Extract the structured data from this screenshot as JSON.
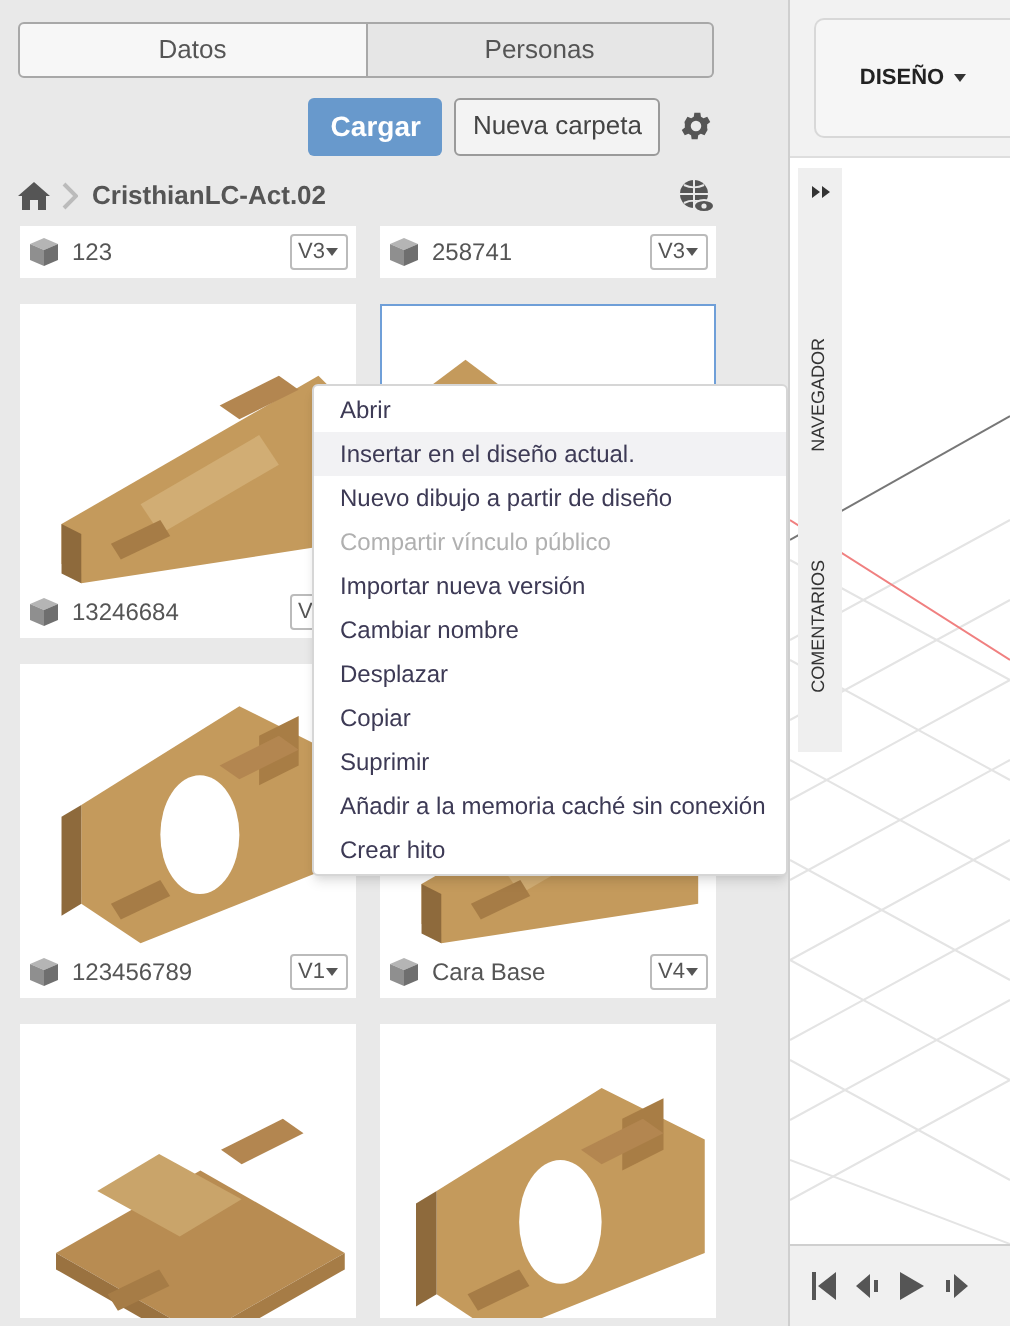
{
  "tabs": [
    {
      "label": "Datos",
      "selected": true
    },
    {
      "label": "Personas",
      "selected": false
    }
  ],
  "toolbar": {
    "upload_button": "Cargar",
    "new_folder_button": "Nueva carpeta"
  },
  "breadcrumb": {
    "project": "CristhianLC-Act.02"
  },
  "cards": [
    {
      "kind": "label_only",
      "name": "123",
      "version": "V3"
    },
    {
      "kind": "label_only",
      "name": "258741",
      "version": "V3"
    },
    {
      "kind": "full",
      "name": "13246684",
      "version": "V",
      "selected": false
    },
    {
      "kind": "image_only",
      "selected": true
    },
    {
      "kind": "full",
      "name": "123456789",
      "version": "V1",
      "selected": false
    },
    {
      "kind": "full",
      "name": "Cara Base",
      "version": "V4",
      "selected": false
    },
    {
      "kind": "image_only",
      "selected": false
    },
    {
      "kind": "image_only",
      "selected": false
    }
  ],
  "context_menu": [
    {
      "label": "Abrir",
      "disabled": false,
      "selected": false
    },
    {
      "label": "Insertar en el diseño actual.",
      "disabled": false,
      "selected": true
    },
    {
      "label": "Nuevo dibujo a partir de diseño",
      "disabled": false,
      "selected": false
    },
    {
      "label": "Compartir vínculo público",
      "disabled": true,
      "selected": false
    },
    {
      "label": "Importar nueva versión",
      "disabled": false,
      "selected": false
    },
    {
      "label": "Cambiar nombre",
      "disabled": false,
      "selected": false
    },
    {
      "label": "Desplazar",
      "disabled": false,
      "selected": false
    },
    {
      "label": "Copiar",
      "disabled": false,
      "selected": false
    },
    {
      "label": "Suprimir",
      "disabled": false,
      "selected": false
    },
    {
      "label": "Añadir a la memoria caché sin conexión",
      "disabled": false,
      "selected": false
    },
    {
      "label": "Crear hito",
      "disabled": false,
      "selected": false
    }
  ],
  "workspace_button": "DISEÑO",
  "side_panel": {
    "tabs": [
      "NAVEGADOR",
      "COMENTARIOS"
    ]
  }
}
